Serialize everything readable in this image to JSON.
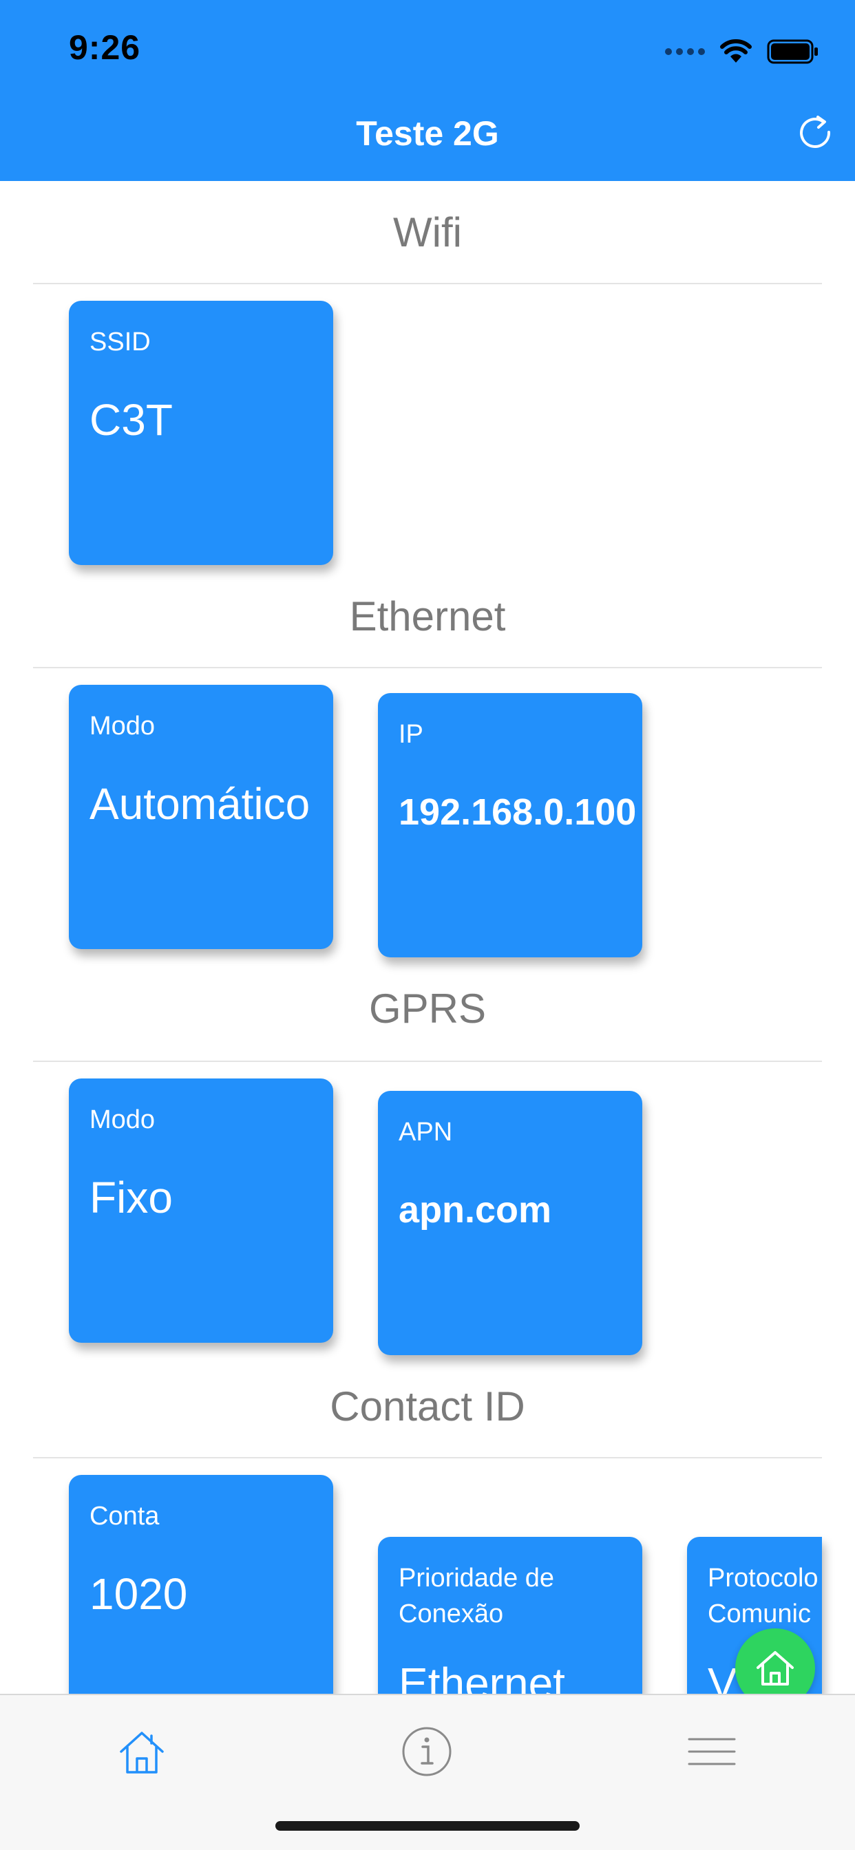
{
  "status_bar": {
    "time": "9:26"
  },
  "header": {
    "title": "Teste 2G",
    "refresh_icon": "refresh-icon"
  },
  "colors": {
    "primary": "#2290fb",
    "fab": "#2ed45f",
    "section_title": "#7a7a7a"
  },
  "sections": {
    "wifi": {
      "title": "Wifi",
      "cards": [
        {
          "label": "SSID",
          "value": "C3T"
        }
      ]
    },
    "ethernet": {
      "title": "Ethernet",
      "cards": [
        {
          "label": "Modo",
          "value": "Automático"
        },
        {
          "label": "IP",
          "value": "192.168.0.100"
        }
      ]
    },
    "gprs": {
      "title": "GPRS",
      "cards": [
        {
          "label": "Modo",
          "value": "Fixo"
        },
        {
          "label": "APN",
          "value": "apn.com"
        }
      ]
    },
    "contact_id": {
      "title": "Contact ID",
      "cards": [
        {
          "label": "Conta",
          "value": "1020"
        },
        {
          "label": "Prioridade de\nConexão",
          "value": "Ethernet"
        },
        {
          "label": "Protocolo\nComunic",
          "value": "V"
        }
      ]
    }
  },
  "fab": {
    "icon": "home-icon"
  },
  "tabbar": {
    "tabs": [
      {
        "icon": "home-icon",
        "active": true
      },
      {
        "icon": "info-icon",
        "active": false
      },
      {
        "icon": "menu-icon",
        "active": false
      }
    ]
  }
}
